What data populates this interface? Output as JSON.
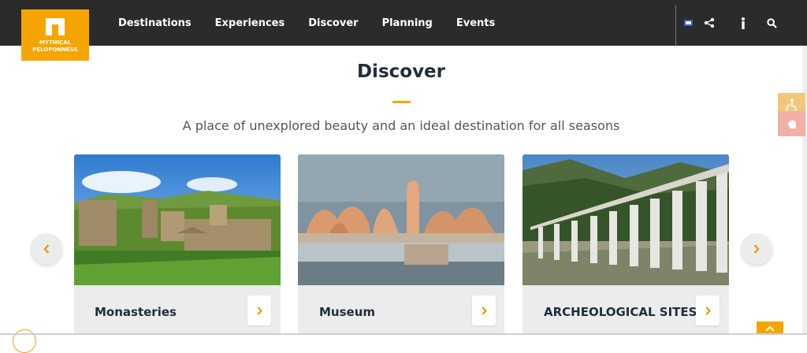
{
  "header": {
    "logo_line1": "MYTHICAL",
    "logo_line2": "PELOPONNESE",
    "nav": [
      "Destinations",
      "Experiences",
      "Discover",
      "Planning",
      "Events"
    ],
    "tool_icons": [
      "flag-icon",
      "share-icon",
      "info-icon",
      "search-icon"
    ]
  },
  "section": {
    "title": "Discover",
    "subtitle": "A place of unexplored beauty and an ideal destination for all seasons"
  },
  "cards": [
    {
      "label": "Monasteries"
    },
    {
      "label": "Museum"
    },
    {
      "label": "ARCHEOLOGICAL SITES"
    }
  ],
  "colors": {
    "header_bg": "#2b2b2b",
    "accent": "#f6a500",
    "card_bg": "#ececec",
    "title": "#1f2d3d"
  }
}
